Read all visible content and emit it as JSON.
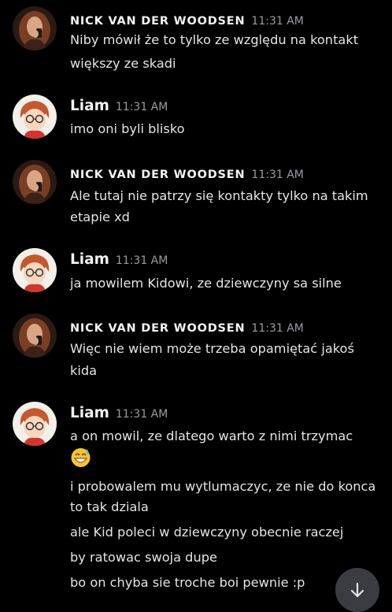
{
  "accent": "#f2f3f5",
  "messages": [
    {
      "author": "NICK VAN DER WOODSEN",
      "time": "11:31 AM",
      "avatar": "nick-avatar",
      "lines": [
        "Niby mówił że to tylko ze względu na kontakt",
        "większy ze skadi"
      ]
    },
    {
      "author": "Liam",
      "time": "11:31 AM",
      "avatar": "liam-avatar",
      "lines": [
        "imo oni byli blisko"
      ]
    },
    {
      "author": "NICK VAN DER WOODSEN",
      "time": "11:31 AM",
      "avatar": "nick-avatar",
      "lines": [
        "Ale tutaj nie patrzy się kontakty tylko na takim",
        "etapie xd"
      ]
    },
    {
      "author": "Liam",
      "time": "11:31 AM",
      "avatar": "liam-avatar",
      "lines": [
        "ja mowilem Kidowi, ze dziewczyny sa silne"
      ]
    },
    {
      "author": "NICK VAN DER WOODSEN",
      "time": "11:31 AM",
      "avatar": "nick-avatar",
      "lines": [
        "Więc nie wiem może trzeba opamiętać jakoś",
        "kida"
      ]
    },
    {
      "author": "Liam",
      "time": "11:31 AM",
      "avatar": "liam-avatar",
      "lines": [
        "a on mowil, ze dlatego warto z nimi trzymac",
        "i probowalem mu wytlumaczyc, ze nie do konca",
        "to tak dziala",
        "ale Kid poleci w dziewczyny obecnie raczej",
        "by ratowac swoja dupe",
        "bo on chyba sie troche boi pewnie :p"
      ],
      "emoji": "grinning-sweat-emoji"
    }
  ],
  "scroll_button": {
    "icon": "arrow-down-icon"
  }
}
